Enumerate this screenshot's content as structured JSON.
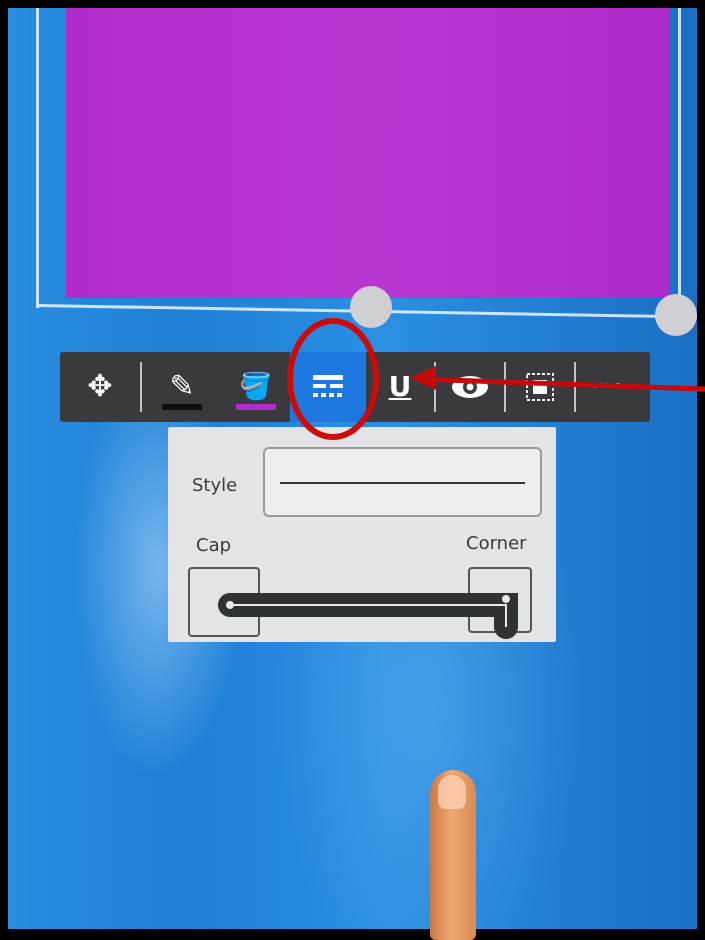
{
  "toolbar": {
    "tools": [
      {
        "id": "move",
        "icon": "move-arrows-icon",
        "glyph": "✥"
      },
      {
        "id": "pen",
        "icon": "pencil-icon",
        "glyph": "✎",
        "swatch_color": "#111111"
      },
      {
        "id": "fill",
        "icon": "paint-bucket-icon",
        "glyph": "⛽",
        "swatch_color": "#b12ccd"
      },
      {
        "id": "line-style",
        "icon": "line-style-icon",
        "glyph": "☰",
        "active": true
      },
      {
        "id": "underline",
        "icon": "underline-icon",
        "glyph": "U"
      },
      {
        "id": "visibility",
        "icon": "eye-icon",
        "glyph": "◉"
      },
      {
        "id": "frame",
        "icon": "frame-icon",
        "glyph": "▣"
      },
      {
        "id": "more",
        "icon": "more-icon",
        "glyph": "•••"
      }
    ]
  },
  "panel": {
    "style_label": "Style",
    "cap_label": "Cap",
    "corner_label": "Corner"
  },
  "colors": {
    "background_blue": "#1f7fd6",
    "shape_fill": "#b12ccd",
    "toolbar_bg": "#3a3a3e",
    "active_tool": "#1e78e0",
    "annotation_red": "#cc0b0b"
  }
}
